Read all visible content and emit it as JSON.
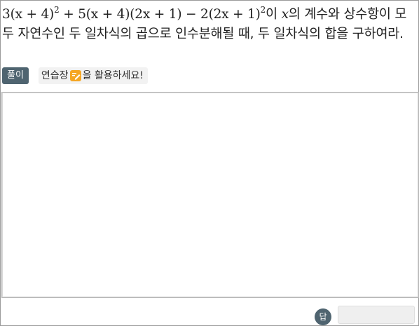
{
  "problem": {
    "coef_3": "3",
    "part_1": "(x + 4)",
    "exp_1": "2",
    "part_2": " + 5(x + 4)(2x + 1) − 2(2x + 1)",
    "exp_2": "2",
    "text_1": "이 ",
    "var_x": "x",
    "text_2": "의 계수와 상수항이 모두 자연수인 두 일차식의 곱으로 인수분해될 때, 두 일차식의 합을 구하여라."
  },
  "toolbar": {
    "solve_label": "풀이",
    "hint_prefix": "연습장",
    "hint_suffix": "을 활용하세요!",
    "pencil_icon": "pencil-note-icon",
    "accent_color": "#4f6470",
    "pencil_color": "#f5a623"
  },
  "answer": {
    "badge_label": "답",
    "value": "",
    "placeholder": ""
  }
}
